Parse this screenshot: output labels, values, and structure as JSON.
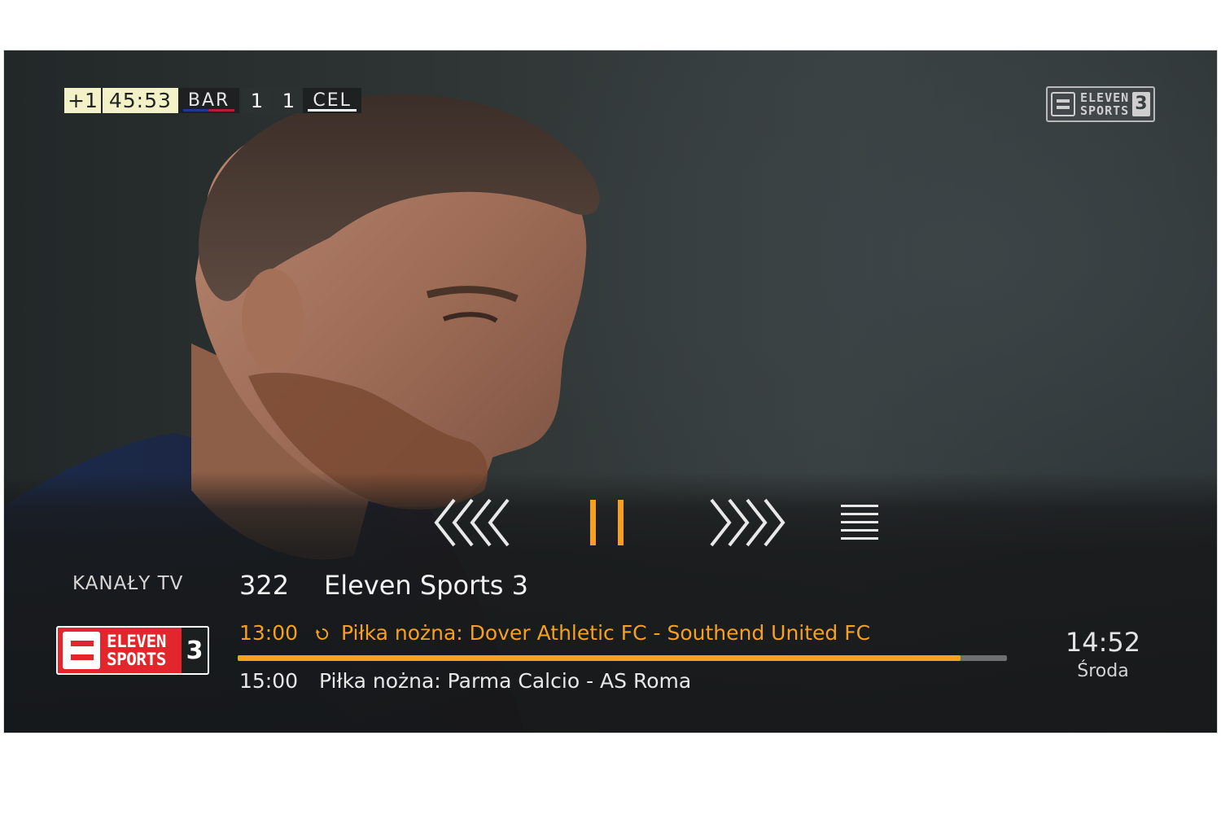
{
  "scorebug": {
    "added_time": "+1",
    "clock": "45:53",
    "home_team": "BAR",
    "home_score": "1",
    "away_score": "1",
    "away_team": "CEL"
  },
  "channel_bug": {
    "line1": "ELEVEN",
    "line2": "SPORTS",
    "number": "3"
  },
  "playback_controls": [
    {
      "name": "rewind",
      "icon": "rewind-icon"
    },
    {
      "name": "pause",
      "icon": "pause-icon"
    },
    {
      "name": "fast-forward",
      "icon": "fast-forward-icon"
    },
    {
      "name": "menu",
      "icon": "menu-icon"
    }
  ],
  "info_bar": {
    "section_label": "KANAŁY TV",
    "channel_number": "322",
    "channel_name": "Eleven Sports 3",
    "logo": {
      "line1": "ELEVEN",
      "line2": "SPORTS",
      "number": "3"
    },
    "now": {
      "time": "13:00",
      "title": "Piłka nożna: Dover Athletic FC - Southend United FC",
      "progress": 0.94
    },
    "next": {
      "time": "15:00",
      "title": "Piłka nożna: Parma Calcio - AS Roma"
    },
    "clock": "14:52",
    "day": "Środa"
  },
  "colors": {
    "accent": "#f5a11d",
    "logo_red": "#e3262b"
  }
}
